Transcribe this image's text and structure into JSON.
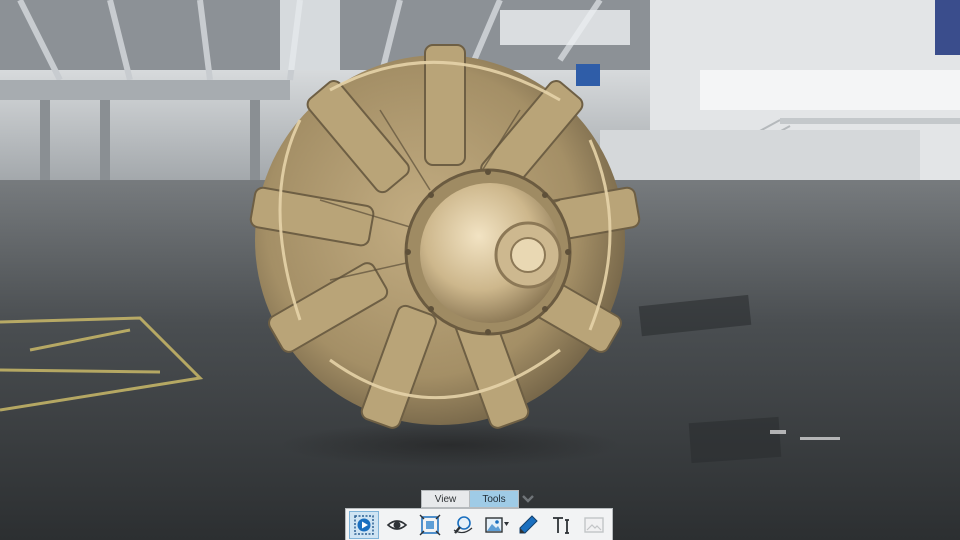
{
  "ribbon": {
    "tabs": [
      {
        "label": "View",
        "active": false
      },
      {
        "label": "Tools",
        "active": true
      }
    ]
  },
  "toolbar": {
    "tools": [
      {
        "icon": "play-frame-icon",
        "state": "active"
      },
      {
        "icon": "eye-icon",
        "state": "normal"
      },
      {
        "icon": "fit-frame-icon",
        "state": "normal"
      },
      {
        "icon": "orbit-magnifier-icon",
        "state": "normal"
      },
      {
        "icon": "environment-image-icon",
        "state": "normal",
        "has_dropdown": true
      },
      {
        "icon": "pencil-icon",
        "state": "normal"
      },
      {
        "icon": "text-cursor-icon",
        "state": "normal"
      },
      {
        "icon": "image-icon",
        "state": "disabled"
      }
    ]
  },
  "colors": {
    "accent": "#1a6fbf",
    "tab_active": "#9fcbe6",
    "engine_tan": "#c9b48a"
  }
}
